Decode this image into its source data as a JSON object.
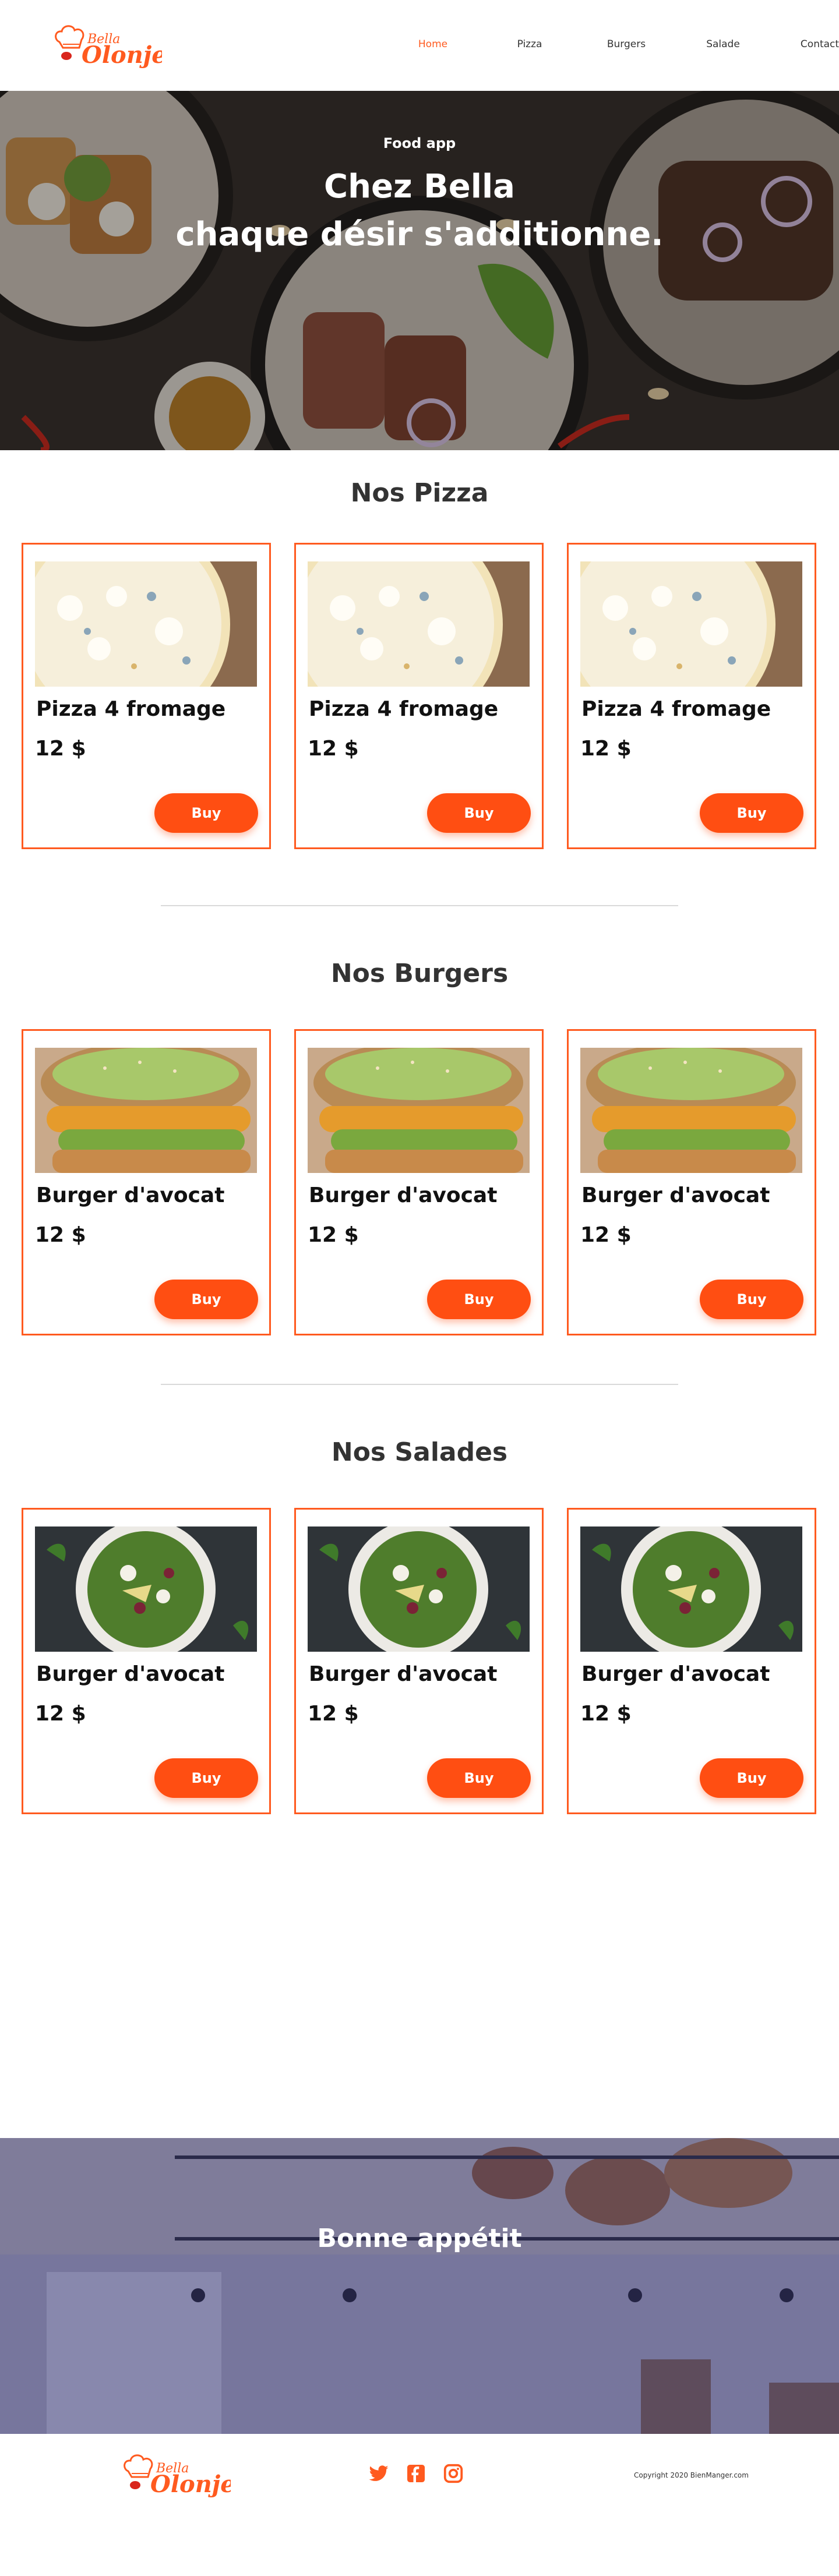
{
  "nav": {
    "links": [
      "Home",
      "Pizza",
      "Burgers",
      "Salade",
      "Contact"
    ],
    "active": "Home"
  },
  "logo": {
    "top_text": "Bella",
    "main_text": "Olonje"
  },
  "hero": {
    "subtitle": "Food app",
    "title_line1": "Chez Bella",
    "title_line2": "chaque désir s'additionne."
  },
  "sections": {
    "pizza": {
      "title": "Nos Pizza",
      "items": [
        {
          "name": "Pizza 4 fromage",
          "price": "12 $",
          "button": "Buy",
          "image": "pizza-photo"
        },
        {
          "name": "Pizza 4 fromage",
          "price": "12 $",
          "button": "Buy",
          "image": "pizza-photo"
        },
        {
          "name": "Pizza 4 fromage",
          "price": "12 $",
          "button": "Buy",
          "image": "pizza-photo"
        }
      ]
    },
    "burgers": {
      "title": "Nos Burgers",
      "items": [
        {
          "name": "Burger d'avocat",
          "price": "12 $",
          "button": "Buy",
          "image": "burger-photo"
        },
        {
          "name": "Burger d'avocat",
          "price": "12 $",
          "button": "Buy",
          "image": "burger-photo"
        },
        {
          "name": "Burger d'avocat",
          "price": "12 $",
          "button": "Buy",
          "image": "burger-photo"
        }
      ]
    },
    "salades": {
      "title": "Nos Salades",
      "items": [
        {
          "name": "Burger d'avocat",
          "price": "12 $",
          "button": "Buy",
          "image": "salad-photo"
        },
        {
          "name": "Burger d'avocat",
          "price": "12 $",
          "button": "Buy",
          "image": "salad-photo"
        },
        {
          "name": "Burger d'avocat",
          "price": "12 $",
          "button": "Buy",
          "image": "salad-photo"
        }
      ]
    }
  },
  "banner": {
    "text": "Bonne appétit"
  },
  "footer": {
    "social_icons": [
      "twitter-icon",
      "facebook-icon",
      "instagram-icon"
    ],
    "copyright": "Copyright 2020 BienManger.com"
  },
  "colors": {
    "accent": "#ff5a1f",
    "button": "#ff4e12",
    "text": "#333333"
  }
}
